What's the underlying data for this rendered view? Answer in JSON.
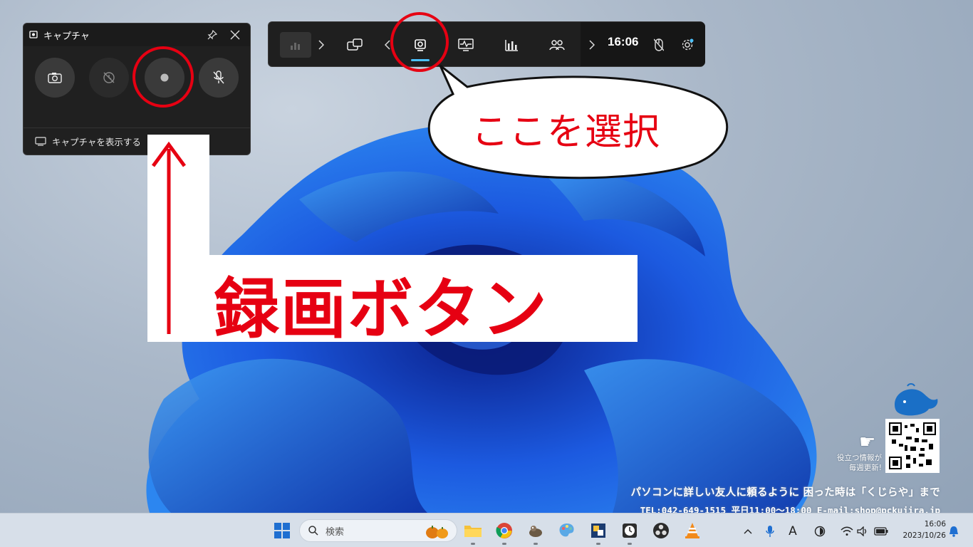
{
  "capture_widget": {
    "title": "キャプチャ",
    "footer_label": "キャプチャを表示する",
    "buttons": [
      "screenshot-button",
      "record-last-button",
      "record-button",
      "mic-button"
    ]
  },
  "game_bar": {
    "clock": "16:06",
    "widgets": [
      "home",
      "widget-menu",
      "capture",
      "performance",
      "resources",
      "social"
    ]
  },
  "annotations": {
    "speech_bubble": "ここを選択",
    "label": "録画ボタン",
    "color": "#e60012"
  },
  "branding": {
    "line1": "パソコンに詳しい友人に頼るように 困った時は「くじらや」まで",
    "line2": "TEL:042-649-1515 平日11:00〜18:00  E-mail:shop@pckujira.jp",
    "tagline_1": "役立つ情報が",
    "tagline_2": "毎週更新!"
  },
  "taskbar": {
    "search_placeholder": "検索",
    "time": "16:06",
    "date": "2023/10/26",
    "tray_ime": "A"
  },
  "colors": {
    "accent_blue": "#4cc2ff",
    "annotation_red": "#e60012"
  }
}
